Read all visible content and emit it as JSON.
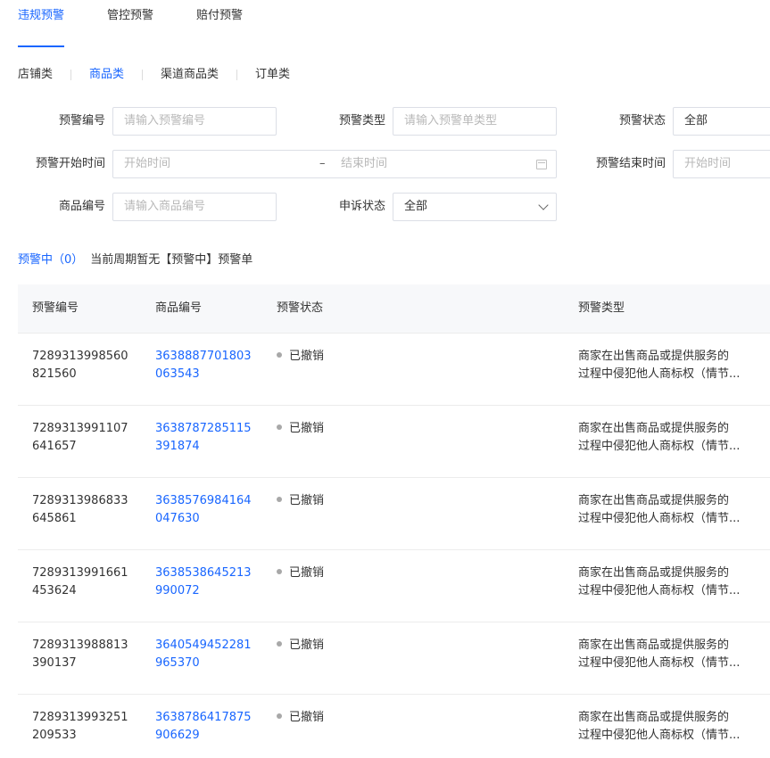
{
  "top_tabs": [
    "违规预警",
    "管控预警",
    "赔付预警"
  ],
  "sub_tabs": [
    "店铺类",
    "商品类",
    "渠道商品类",
    "订单类"
  ],
  "filters": {
    "warning_no": {
      "label": "预警编号",
      "placeholder": "请输入预警编号"
    },
    "warning_type": {
      "label": "预警类型",
      "placeholder": "请输入预警单类型"
    },
    "warning_status": {
      "label": "预警状态",
      "value": "全部"
    },
    "start_time": {
      "label": "预警开始时间",
      "start_placeholder": "开始时间",
      "separator": "–",
      "end_placeholder": "结束时间"
    },
    "end_time": {
      "label": "预警结束时间",
      "start_placeholder": "开始时间"
    },
    "product_no": {
      "label": "商品编号",
      "placeholder": "请输入商品编号"
    },
    "appeal_status": {
      "label": "申诉状态",
      "value": "全部"
    }
  },
  "summary": {
    "tag": "预警中（0）",
    "message": "当前周期暂无【预警中】预警单"
  },
  "table": {
    "columns": [
      "预警编号",
      "商品编号",
      "预警状态",
      "预警类型"
    ],
    "rows": [
      {
        "id": "7289313998560821560",
        "product": "3638887701803063543",
        "status": "已撤销",
        "type_line1": "商家在出售商品或提供服务的",
        "type_line2": "过程中侵犯他人商标权（情节..."
      },
      {
        "id": "7289313991107641657",
        "product": "3638787285115391874",
        "status": "已撤销",
        "type_line1": "商家在出售商品或提供服务的",
        "type_line2": "过程中侵犯他人商标权（情节..."
      },
      {
        "id": "7289313986833645861",
        "product": "3638576984164047630",
        "status": "已撤销",
        "type_line1": "商家在出售商品或提供服务的",
        "type_line2": "过程中侵犯他人商标权（情节..."
      },
      {
        "id": "7289313991661453624",
        "product": "3638538645213990072",
        "status": "已撤销",
        "type_line1": "商家在出售商品或提供服务的",
        "type_line2": "过程中侵犯他人商标权（情节..."
      },
      {
        "id": "7289313988813390137",
        "product": "3640549452281965370",
        "status": "已撤销",
        "type_line1": "商家在出售商品或提供服务的",
        "type_line2": "过程中侵犯他人商标权（情节..."
      },
      {
        "id": "7289313993251209533",
        "product": "3638786417875906629",
        "status": "已撤销",
        "type_line1": "商家在出售商品或提供服务的",
        "type_line2": "过程中侵犯他人商标权（情节..."
      }
    ]
  },
  "colors": {
    "accent": "#1966ff",
    "border": "#dcdfe6",
    "header_bg": "#f7f8fa"
  }
}
